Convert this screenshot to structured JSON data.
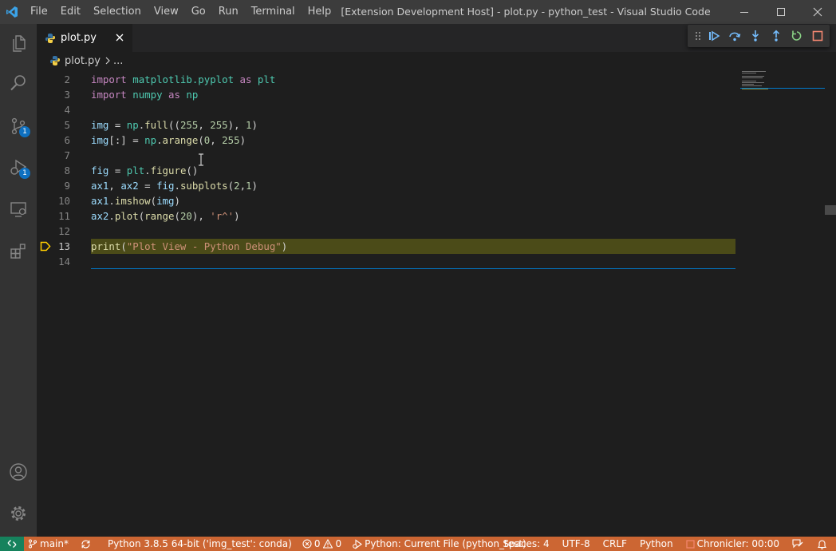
{
  "window": {
    "title": "[Extension Development Host] - plot.py - python_test - Visual Studio Code",
    "menu": [
      "File",
      "Edit",
      "Selection",
      "View",
      "Go",
      "Run",
      "Terminal",
      "Help"
    ]
  },
  "activity_bar": {
    "scm_badge": "1",
    "debug_badge": "1"
  },
  "tab": {
    "label": "plot.py"
  },
  "breadcrumb": {
    "file": "plot.py",
    "more": "..."
  },
  "editor": {
    "current_line": 13,
    "lines": [
      {
        "n": "2",
        "text": "import matplotlib.pyplot as plt"
      },
      {
        "n": "3",
        "text": "import numpy as np"
      },
      {
        "n": "4",
        "text": ""
      },
      {
        "n": "5",
        "text": "img = np.full((255, 255), 1)"
      },
      {
        "n": "6",
        "text": "img[:] = np.arange(0, 255)"
      },
      {
        "n": "7",
        "text": ""
      },
      {
        "n": "8",
        "text": "fig = plt.figure()"
      },
      {
        "n": "9",
        "text": "ax1, ax2 = fig.subplots(2,1)"
      },
      {
        "n": "10",
        "text": "ax1.imshow(img)"
      },
      {
        "n": "11",
        "text": "ax2.plot(range(20), 'r^')"
      },
      {
        "n": "12",
        "text": ""
      },
      {
        "n": "13",
        "text": "print(\"Plot View - Python Debug\")"
      },
      {
        "n": "14",
        "text": ""
      }
    ]
  },
  "statusbar": {
    "branch": "main*",
    "interpreter": "Python 3.8.5 64-bit ('img_test': conda)",
    "errors": "0",
    "warnings": "0",
    "debug_config": "Python: Current File (python_test)",
    "spaces": "Spaces: 4",
    "encoding": "UTF-8",
    "eol": "CRLF",
    "language": "Python",
    "chronicler": "Chronicler: 00:00"
  },
  "colors": {
    "statusbar_debug": "#cc6633",
    "remote": "#16825d",
    "accent": "#007acc",
    "current_line_highlight": "#4b4b18"
  }
}
